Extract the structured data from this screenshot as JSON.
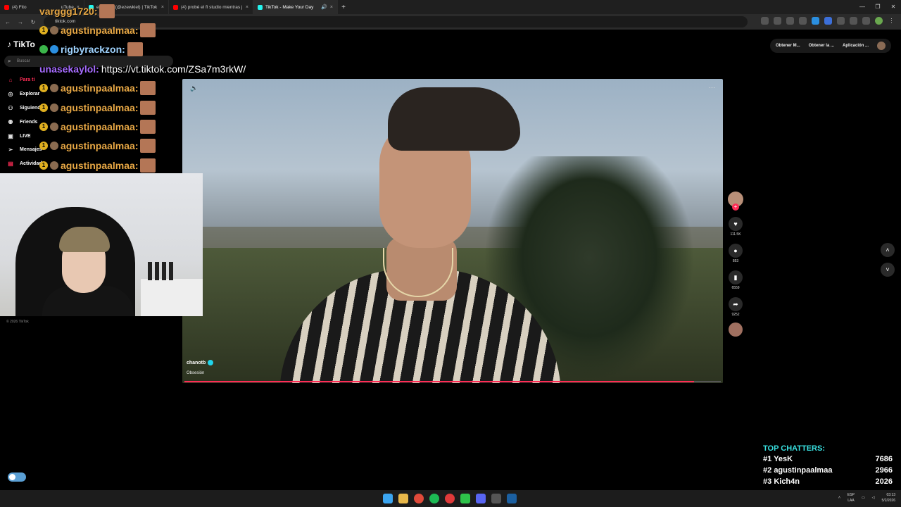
{
  "browser": {
    "tabs": [
      {
        "label": "(4) Fito",
        "active": false,
        "favicon_color": "#ff0000"
      },
      {
        "label": "ezewkiel (@ezewkiel) | TikTok",
        "active": false,
        "favicon_color": "#25f4ee"
      },
      {
        "label": "(4) probé el fl studio mientras j",
        "active": false,
        "favicon_color": "#ff0000"
      },
      {
        "label": "TikTok - Make Your Day",
        "active": true,
        "favicon_color": "#25f4ee"
      }
    ],
    "tab_fragment": "uTube",
    "address": "tiktok.com"
  },
  "tiktok": {
    "logo": "TikTo",
    "search_placeholder": "Buscar",
    "nav": [
      {
        "label": "Para ti",
        "icon": "home-icon",
        "active": true
      },
      {
        "label": "Explorar",
        "icon": "compass-icon",
        "active": false
      },
      {
        "label": "Siguiendo",
        "icon": "following-icon",
        "active": false
      },
      {
        "label": "Friends",
        "icon": "friends-icon",
        "active": false
      },
      {
        "label": "LIVE",
        "icon": "live-icon",
        "active": false
      },
      {
        "label": "Mensajes",
        "icon": "messages-icon",
        "active": false
      },
      {
        "label": "Actividad",
        "icon": "activity-icon",
        "active": false
      }
    ],
    "copyright": "© 2026 TikTok",
    "top_actions": [
      "Obtener M...",
      "Obtener la ...",
      "Aplicación ..."
    ],
    "video": {
      "author": "chanotb",
      "caption": "Obsesión",
      "progress": 0.95
    },
    "actions": {
      "likes": "111.5K",
      "comments": "853",
      "saves": "6559",
      "shares": "9252"
    }
  },
  "chat_overlay": {
    "lines": [
      {
        "user": "varggg1720:",
        "message": "",
        "style": "gold"
      },
      {
        "user": "agustinpaalmaa:",
        "message": "",
        "style": "gold"
      },
      {
        "user": "rigbyrackzon:",
        "message": "",
        "style": "blue"
      },
      {
        "user": "unasekaylol:",
        "message": "https://vt.tiktok.com/ZSa7m3rkW/",
        "style": "purple"
      },
      {
        "user": "agustinpaalmaa:",
        "message": "",
        "style": "gold"
      },
      {
        "user": "agustinpaalmaa:",
        "message": "",
        "style": "gold"
      },
      {
        "user": "agustinpaalmaa:",
        "message": "",
        "style": "gold"
      },
      {
        "user": "agustinpaalmaa:",
        "message": "",
        "style": "gold"
      },
      {
        "user": "agustinpaalmaa:",
        "message": "",
        "style": "gold"
      }
    ]
  },
  "top_chatters": {
    "title": "TOP CHATTERS:",
    "rows": [
      {
        "rank": "#1",
        "name": "YesK",
        "count": "7686"
      },
      {
        "rank": "#2",
        "name": "agustinpaalmaa",
        "count": "2966"
      },
      {
        "rank": "#3",
        "name": "Kich4n",
        "count": "2026"
      }
    ]
  },
  "taskbar": {
    "lang": "ESP",
    "lang2": "LAA",
    "time": "03:13",
    "date": "5/2/2026"
  },
  "colors": {
    "accent": "#fe2c55",
    "chatters_title": "#39e0e0"
  }
}
